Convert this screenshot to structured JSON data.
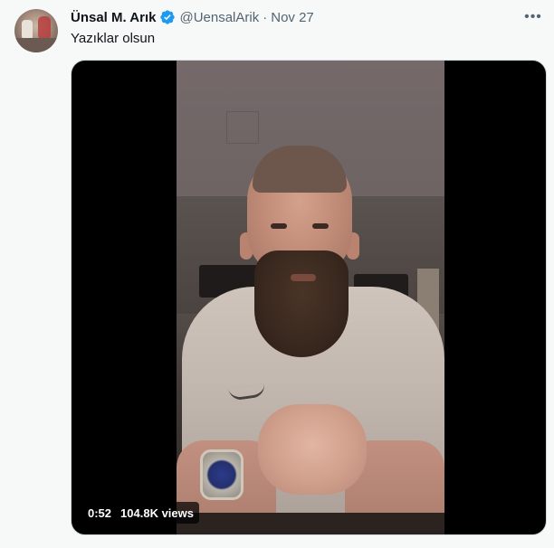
{
  "tweet": {
    "author_name": "Ünsal M. Arık",
    "handle": "@UensalArik",
    "separator": "·",
    "date": "Nov 27",
    "text": "Yazıklar olsun",
    "verified": true,
    "more_icon": "more-horizontal-icon"
  },
  "video": {
    "duration": "0:52",
    "views": "104.8K views"
  },
  "colors": {
    "verified_blue": "#1d9bf0",
    "text_primary": "#0f1419",
    "text_secondary": "#536471",
    "background": "#f7f9f9"
  }
}
